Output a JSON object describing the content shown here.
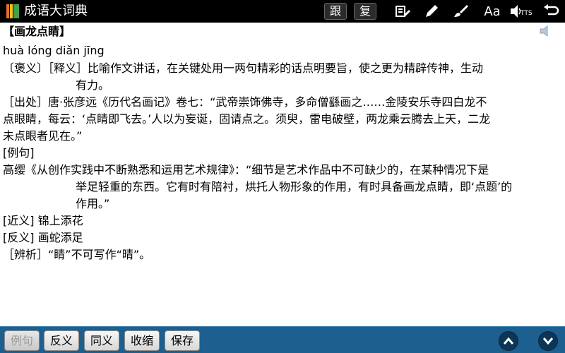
{
  "app": {
    "title": "成语大词典"
  },
  "toolbar": {
    "follow_label": "跟",
    "review_label": "复",
    "tts_label": "TTS",
    "font_label": "Aa"
  },
  "entry": {
    "title": "【画龙点睛】",
    "pinyin": "huà lóng diǎn jīng",
    "lines": [
      "〔褒义〕［释义］比喻作文讲话，在关键处用一两句精彩的话点明要旨，使之更为精辟传神，生动",
      "有力。",
      "［出处］唐·张彦远《历代名画记》卷七：“武帝崇饰佛寺，多命僧繇画之……金陵安乐寺四白龙不",
      "点眼睛，每云：‘点睛即飞去。’人以为妄诞，固请点之。须臾，雷电破壁，两龙乘云腾去上天，二龙",
      "未点眼者见在。”",
      "[例句]",
      "高缨《从创作实践中不断熟悉和运用艺术规律》：“细节是艺术作品中不可缺少的，在某种情况下是",
      "举足轻重的东西。它有时有陪衬，烘托人物形象的作用，有时具备画龙点睛，即‘点题’的",
      "作用。”",
      "[近义] 锦上添花",
      "[反义] 画蛇添足",
      "［辨析］“睛”不可写作“晴”。"
    ]
  },
  "bottom": {
    "buttons": [
      "例句",
      "反义",
      "同义",
      "收缩",
      "保存"
    ]
  },
  "colors": {
    "topbar": "#000000",
    "bottombar": "#1d5f8f",
    "nav_button": "#0d3556"
  }
}
